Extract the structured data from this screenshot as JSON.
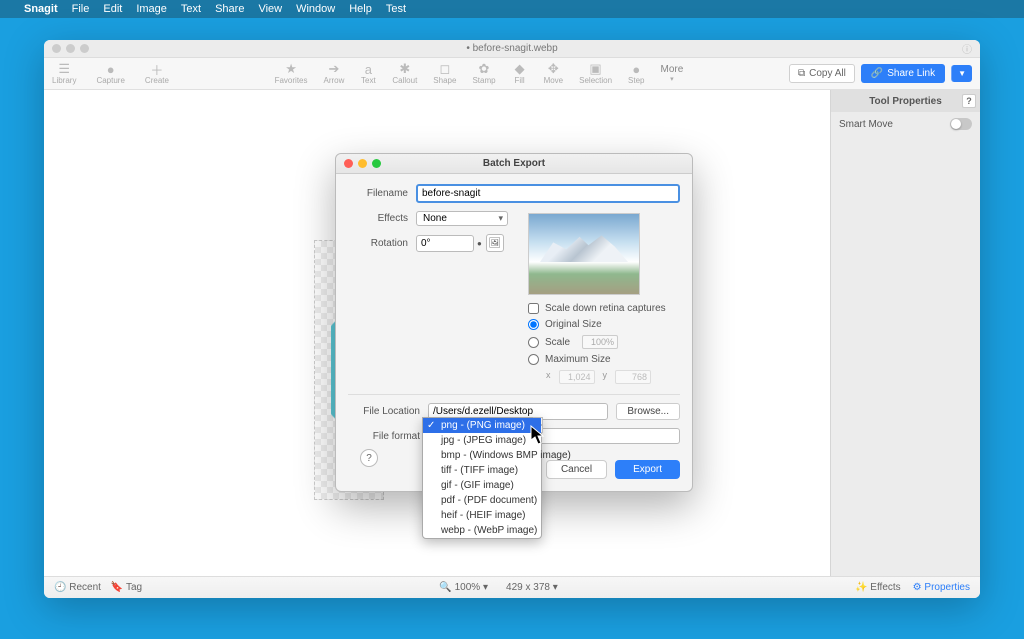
{
  "menubar": {
    "app": "Snagit",
    "items": [
      "File",
      "Edit",
      "Image",
      "Text",
      "Share",
      "View",
      "Window",
      "Help",
      "Test"
    ]
  },
  "window": {
    "title": "• before-snagit.webp",
    "toolbar": {
      "left": [
        {
          "name": "library",
          "label": "Library"
        },
        {
          "name": "capture",
          "label": "Capture"
        },
        {
          "name": "create",
          "label": "Create"
        }
      ],
      "center": [
        {
          "name": "favorites",
          "label": "Favorites",
          "glyph": "★"
        },
        {
          "name": "arrow",
          "label": "Arrow",
          "glyph": "➔"
        },
        {
          "name": "text",
          "label": "Text",
          "glyph": "a"
        },
        {
          "name": "callout",
          "label": "Callout",
          "glyph": "✱"
        },
        {
          "name": "shape",
          "label": "Shape",
          "glyph": "◻"
        },
        {
          "name": "stamp",
          "label": "Stamp",
          "glyph": "✿"
        },
        {
          "name": "fill",
          "label": "Fill",
          "glyph": "◆"
        },
        {
          "name": "move",
          "label": "Move",
          "glyph": "✥"
        },
        {
          "name": "selection",
          "label": "Selection",
          "glyph": "▣"
        },
        {
          "name": "step",
          "label": "Step",
          "glyph": "●"
        }
      ],
      "more_label": "More",
      "copy_all": "Copy All",
      "share_link": "Share Link"
    },
    "side_panel": {
      "header": "Tool Properties",
      "smart_move": "Smart Move"
    },
    "statusbar": {
      "recent": "Recent",
      "tag": "Tag",
      "zoom": "100%",
      "dims": "429 x 378",
      "effects": "Effects",
      "properties": "Properties"
    }
  },
  "modal": {
    "title": "Batch Export",
    "filename_label": "Filename",
    "filename_value": "before-snagit",
    "effects_label": "Effects",
    "effects_value": "None",
    "rotation_label": "Rotation",
    "rotation_value": "0°",
    "scale_down": "Scale down retina captures",
    "original_size": "Original Size",
    "scale_label": "Scale",
    "scale_value": "100%",
    "max_size": "Maximum Size",
    "x_label": "x",
    "x_value": "1,024",
    "y_label": "y",
    "y_value": "768",
    "file_location_label": "File Location",
    "file_location_value": "/Users/d.ezell/Desktop",
    "browse": "Browse...",
    "file_format_label": "File format",
    "cancel": "Cancel",
    "export": "Export",
    "format_options": [
      {
        "label": "png - (PNG image)",
        "selected": true
      },
      {
        "label": "jpg - (JPEG image)"
      },
      {
        "label": "bmp - (Windows BMP image)"
      },
      {
        "label": "tiff - (TIFF image)"
      },
      {
        "label": "gif - (GIF image)"
      },
      {
        "label": "pdf - (PDF document)"
      },
      {
        "label": "heif - (HEIF image)"
      },
      {
        "label": "webp - (WebP image)"
      }
    ]
  }
}
